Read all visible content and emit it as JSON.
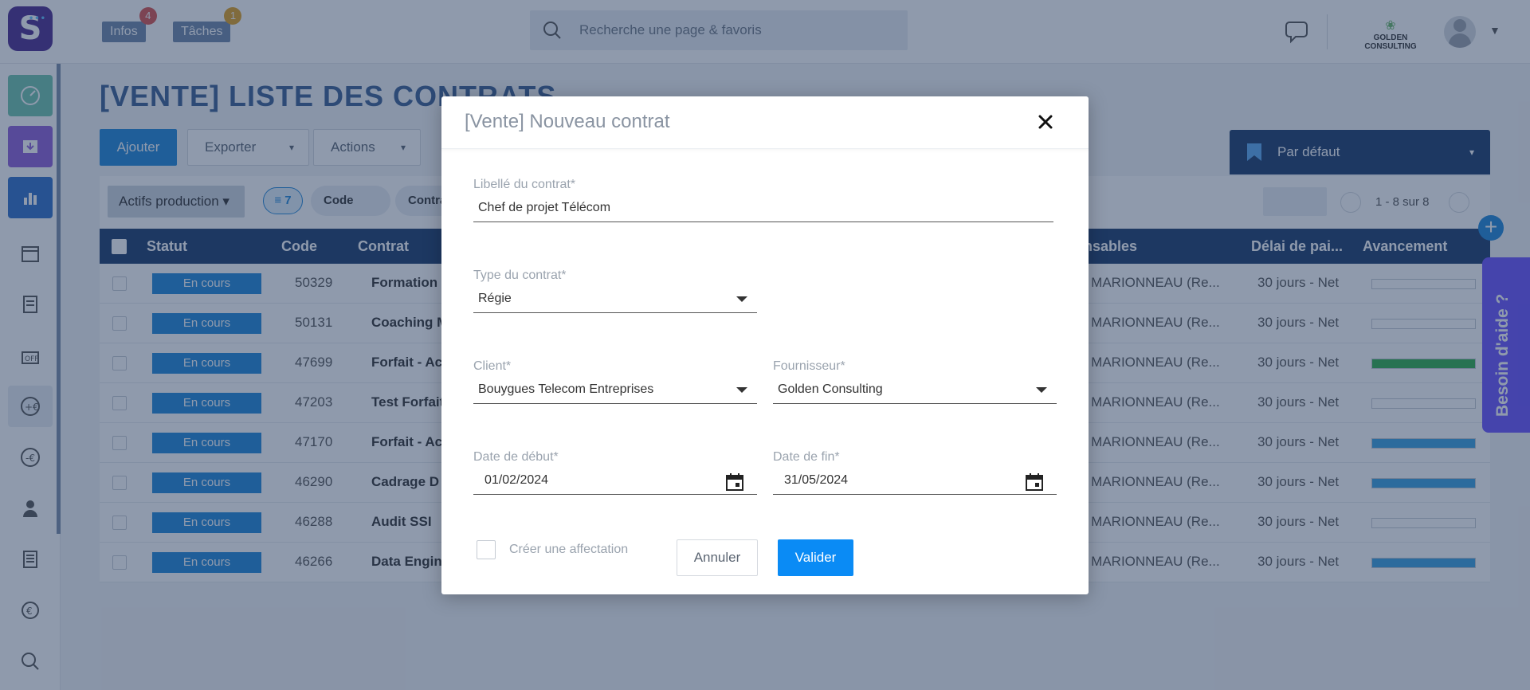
{
  "topbar": {
    "infos_label": "Infos",
    "infos_badge": "4",
    "taches_label": "Tâches",
    "taches_badge": "1",
    "search_placeholder": "Recherche une page & favoris",
    "company": "GOLDEN CONSULTING",
    "badge_colors": {
      "infos": "#d9534f",
      "taches": "#e0a020"
    }
  },
  "sidebar": {
    "items": [
      {
        "icon": "dashboard-icon",
        "color": "#6fc4ad"
      },
      {
        "icon": "inbox-icon",
        "color": "#8e5ed8"
      },
      {
        "icon": "bar-chart-icon",
        "color": "#2f6fc8"
      },
      {
        "icon": "calendar-icon",
        "color": "#ffffff"
      },
      {
        "icon": "document-icon",
        "color": "#ffffff"
      },
      {
        "icon": "off-icon",
        "color": "#ffffff"
      },
      {
        "icon": "euro-plus-icon",
        "color": "#ffffff"
      },
      {
        "icon": "euro-minus-icon",
        "color": "#ffffff"
      },
      {
        "icon": "user-icon",
        "color": "#ffffff"
      },
      {
        "icon": "report-icon",
        "color": "#ffffff"
      },
      {
        "icon": "currency-cycle-icon",
        "color": "#ffffff"
      },
      {
        "icon": "magnifier-chart-icon",
        "color": "#ffffff"
      }
    ]
  },
  "page": {
    "title": "[VENTE] LISTE DES CONTRATS",
    "ajouter": "Ajouter",
    "exporter": "Exporter",
    "actions": "Actions",
    "preset": "Par défaut",
    "filter_select": "Actifs production",
    "filter_count": "7",
    "chip_code": "Code",
    "chip_contrat": "Contrat",
    "pagination": "1 - 8 sur 8"
  },
  "table": {
    "headers": {
      "statut": "Statut",
      "code": "Code",
      "contrat": "Contrat",
      "responsables": "nsables",
      "delai": "Délai de pai...",
      "avancement": "Avancement"
    },
    "rows": [
      {
        "statut": "En cours",
        "code": "50329",
        "contrat": "Formation",
        "resp": "e MARIONNEAU (Re...",
        "delai": "30 jours - Net",
        "progress": 0,
        "progress_color": "#38a0e0"
      },
      {
        "statut": "En cours",
        "code": "50131",
        "contrat": "Coaching M",
        "resp": "e MARIONNEAU (Re...",
        "delai": "30 jours - Net",
        "progress": 0,
        "progress_color": "#38a0e0"
      },
      {
        "statut": "En cours",
        "code": "47699",
        "contrat": "Forfait - Ac",
        "resp": "e MARIONNEAU (Re...",
        "delai": "30 jours - Net",
        "progress": 100,
        "progress_color": "#2fae4b"
      },
      {
        "statut": "En cours",
        "code": "47203",
        "contrat": "Test Forfait",
        "resp": "e MARIONNEAU (Re...",
        "delai": "30 jours - Net",
        "progress": 0,
        "progress_color": "#38a0e0"
      },
      {
        "statut": "En cours",
        "code": "47170",
        "contrat": "Forfait - Ac",
        "resp": "e MARIONNEAU (Re...",
        "delai": "30 jours - Net",
        "progress": 100,
        "progress_color": "#38a0e0"
      },
      {
        "statut": "En cours",
        "code": "46290",
        "contrat": "Cadrage D",
        "resp": "e MARIONNEAU (Re...",
        "delai": "30 jours - Net",
        "progress": 100,
        "progress_color": "#38a0e0"
      },
      {
        "statut": "En cours",
        "code": "46288",
        "contrat": "Audit SSI",
        "resp": "e MARIONNEAU (Re...",
        "delai": "30 jours - Net",
        "progress": 0,
        "progress_color": "#38a0e0"
      },
      {
        "statut": "En cours",
        "code": "46266",
        "contrat": "Data Engin",
        "resp": "e MARIONNEAU (Re...",
        "delai": "30 jours - Net",
        "progress": 100,
        "progress_color": "#38a0e0"
      }
    ]
  },
  "help_tab": "Besoin d'aide ?",
  "modal": {
    "title": "[Vente] Nouveau contrat",
    "libelle_label": "Libellé du contrat*",
    "libelle_value": "Chef de projet Télécom",
    "type_label": "Type du contrat*",
    "type_value": "Régie",
    "client_label": "Client*",
    "client_value": "Bouygues Telecom Entreprises",
    "fournisseur_label": "Fournisseur*",
    "fournisseur_value": "Golden Consulting",
    "debut_label": "Date de début*",
    "debut_value": "01/02/2024",
    "fin_label": "Date de fin*",
    "fin_value": "31/05/2024",
    "create_affectation": "Créer une affectation",
    "annuler": "Annuler",
    "valider": "Valider"
  }
}
